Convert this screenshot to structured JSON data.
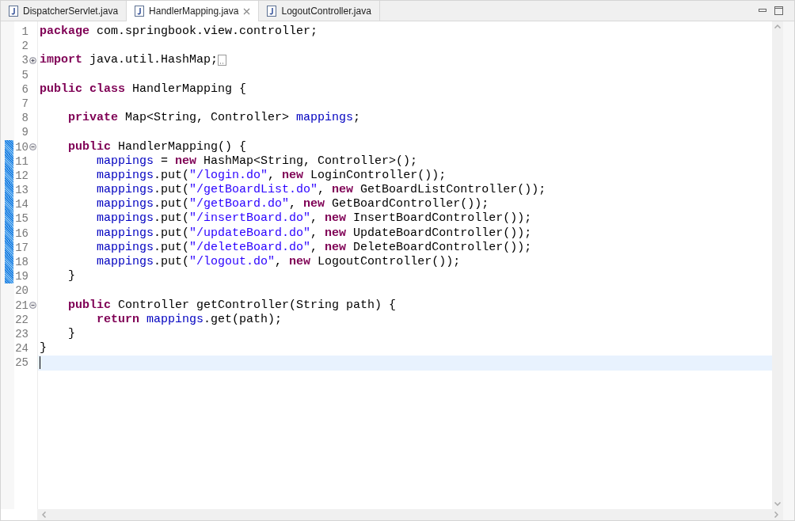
{
  "tabs": [
    {
      "label": "DispatcherServlet.java",
      "selected": false
    },
    {
      "label": "HandlerMapping.java",
      "selected": true
    },
    {
      "label": "LogoutController.java",
      "selected": false
    }
  ],
  "editor": {
    "lines": [
      {
        "number": "1",
        "tokens": [
          {
            "kind": "keyword",
            "text": "package"
          },
          {
            "kind": "plain",
            "text": " com.springbook.view.controller;"
          }
        ]
      },
      {
        "number": "2"
      },
      {
        "number": "3",
        "folded": true,
        "tokens": [
          {
            "kind": "keyword",
            "text": "import"
          },
          {
            "kind": "plain",
            "text": " java.util.HashMap;"
          }
        ]
      },
      {
        "number": "5"
      },
      {
        "number": "6",
        "tokens": [
          {
            "kind": "keyword",
            "text": "public"
          },
          {
            "kind": "keyword",
            "text": " class"
          },
          {
            "kind": "plain",
            "text": " HandlerMapping {"
          }
        ]
      },
      {
        "number": "7"
      },
      {
        "number": "8",
        "tokens": [
          {
            "kind": "keyword",
            "text": "    private"
          },
          {
            "kind": "plain",
            "text": " Map<String, Controller> "
          },
          {
            "kind": "field",
            "text": "mappings"
          },
          {
            "kind": "plain",
            "text": ";"
          }
        ]
      },
      {
        "number": "9"
      },
      {
        "number": "10",
        "folded": false,
        "changed": true,
        "tokens": [
          {
            "kind": "keyword",
            "text": "    public"
          },
          {
            "kind": "plain",
            "text": " HandlerMapping() {"
          }
        ]
      },
      {
        "number": "11",
        "changed": true,
        "tokens": [
          {
            "kind": "field",
            "text": "        mappings"
          },
          {
            "kind": "plain",
            "text": " = "
          },
          {
            "kind": "keyword",
            "text": "new"
          },
          {
            "kind": "plain",
            "text": " HashMap<String, Controller>();"
          }
        ]
      },
      {
        "number": "12",
        "changed": true,
        "tokens": [
          {
            "kind": "field",
            "text": "        mappings"
          },
          {
            "kind": "plain",
            "text": ".put("
          },
          {
            "kind": "string",
            "text": "\"/login.do\""
          },
          {
            "kind": "plain",
            "text": ", "
          },
          {
            "kind": "keyword",
            "text": "new"
          },
          {
            "kind": "plain",
            "text": " LoginController());"
          }
        ]
      },
      {
        "number": "13",
        "changed": true,
        "tokens": [
          {
            "kind": "field",
            "text": "        mappings"
          },
          {
            "kind": "plain",
            "text": ".put("
          },
          {
            "kind": "string",
            "text": "\"/getBoardList.do\""
          },
          {
            "kind": "plain",
            "text": ", "
          },
          {
            "kind": "keyword",
            "text": "new"
          },
          {
            "kind": "plain",
            "text": " GetBoardListController());"
          }
        ]
      },
      {
        "number": "14",
        "changed": true,
        "tokens": [
          {
            "kind": "field",
            "text": "        mappings"
          },
          {
            "kind": "plain",
            "text": ".put("
          },
          {
            "kind": "string",
            "text": "\"/getBoard.do\""
          },
          {
            "kind": "plain",
            "text": ", "
          },
          {
            "kind": "keyword",
            "text": "new"
          },
          {
            "kind": "plain",
            "text": " GetBoardController());"
          }
        ]
      },
      {
        "number": "15",
        "changed": true,
        "tokens": [
          {
            "kind": "field",
            "text": "        mappings"
          },
          {
            "kind": "plain",
            "text": ".put("
          },
          {
            "kind": "string",
            "text": "\"/insertBoard.do\""
          },
          {
            "kind": "plain",
            "text": ", "
          },
          {
            "kind": "keyword",
            "text": "new"
          },
          {
            "kind": "plain",
            "text": " InsertBoardController());"
          }
        ]
      },
      {
        "number": "16",
        "changed": true,
        "tokens": [
          {
            "kind": "field",
            "text": "        mappings"
          },
          {
            "kind": "plain",
            "text": ".put("
          },
          {
            "kind": "string",
            "text": "\"/updateBoard.do\""
          },
          {
            "kind": "plain",
            "text": ", "
          },
          {
            "kind": "keyword",
            "text": "new"
          },
          {
            "kind": "plain",
            "text": " UpdateBoardController());"
          }
        ]
      },
      {
        "number": "17",
        "changed": true,
        "tokens": [
          {
            "kind": "field",
            "text": "        mappings"
          },
          {
            "kind": "plain",
            "text": ".put("
          },
          {
            "kind": "string",
            "text": "\"/deleteBoard.do\""
          },
          {
            "kind": "plain",
            "text": ", "
          },
          {
            "kind": "keyword",
            "text": "new"
          },
          {
            "kind": "plain",
            "text": " DeleteBoardController());"
          }
        ]
      },
      {
        "number": "18",
        "changed": true,
        "tokens": [
          {
            "kind": "field",
            "text": "        mappings"
          },
          {
            "kind": "plain",
            "text": ".put("
          },
          {
            "kind": "string",
            "text": "\"/logout.do\""
          },
          {
            "kind": "plain",
            "text": ", "
          },
          {
            "kind": "keyword",
            "text": "new"
          },
          {
            "kind": "plain",
            "text": " LogoutController());"
          }
        ]
      },
      {
        "number": "19",
        "changed": true,
        "tokens": [
          {
            "kind": "plain",
            "text": "    }"
          }
        ]
      },
      {
        "number": "20"
      },
      {
        "number": "21",
        "folded": false,
        "tokens": [
          {
            "kind": "keyword",
            "text": "    public"
          },
          {
            "kind": "plain",
            "text": " Controller getController(String path) {"
          }
        ]
      },
      {
        "number": "22",
        "tokens": [
          {
            "kind": "keyword",
            "text": "        return"
          },
          {
            "kind": "field",
            "text": " mappings"
          },
          {
            "kind": "plain",
            "text": ".get(path);"
          }
        ]
      },
      {
        "number": "23",
        "tokens": [
          {
            "kind": "plain",
            "text": "    }"
          }
        ]
      },
      {
        "number": "24",
        "tokens": [
          {
            "kind": "plain",
            "text": "}"
          }
        ]
      },
      {
        "number": "25",
        "current": true
      }
    ]
  }
}
